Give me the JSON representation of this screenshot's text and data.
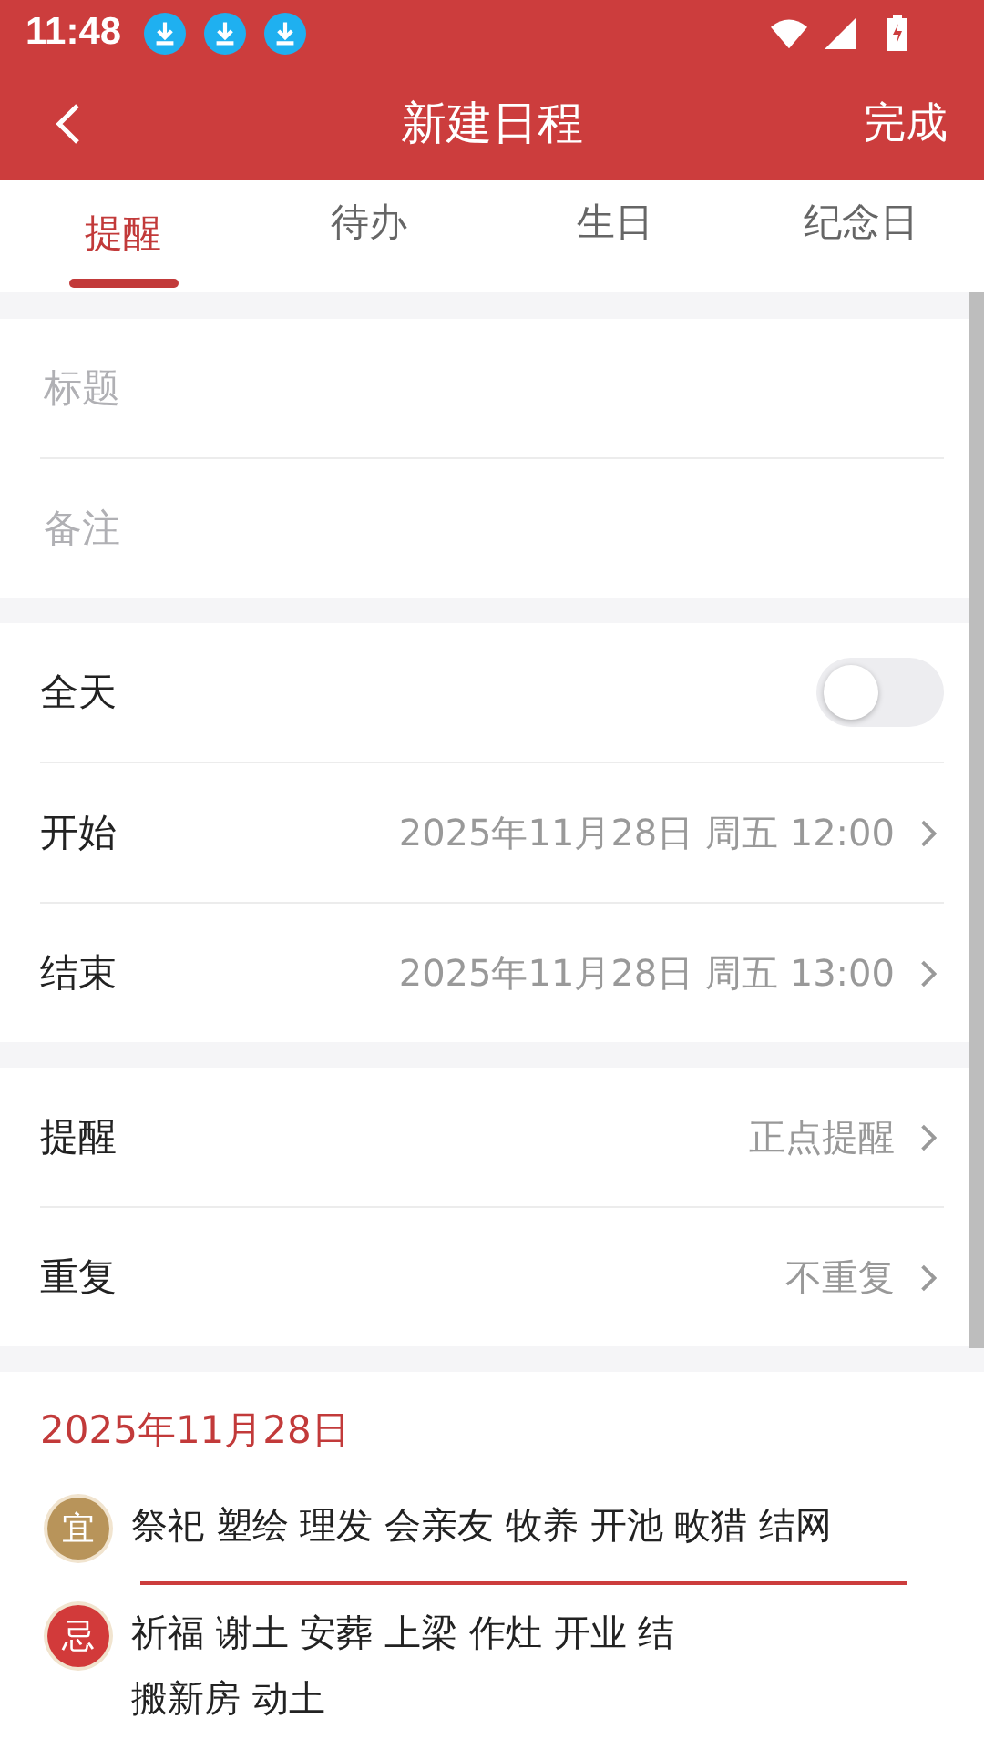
{
  "status_bar": {
    "time": "11:48",
    "notifications": [
      {
        "kind": "download"
      },
      {
        "kind": "download"
      },
      {
        "kind": "download"
      }
    ]
  },
  "header": {
    "title": "新建日程",
    "action": "完成"
  },
  "tabs": [
    {
      "label": "提醒",
      "selected": true
    },
    {
      "label": "待办",
      "selected": false
    },
    {
      "label": "生日",
      "selected": false
    },
    {
      "label": "纪念日",
      "selected": false
    }
  ],
  "inputs": [
    {
      "placeholder": "标题"
    },
    {
      "placeholder": "备注"
    }
  ],
  "time_section": {
    "all_day": {
      "label": "全天",
      "on": false
    },
    "rows": [
      {
        "label": "开始",
        "value": "2025年11月28日 周五 12:00"
      },
      {
        "label": "结束",
        "value": "2025年11月28日 周五 13:00"
      }
    ]
  },
  "reminder_section": [
    {
      "label": "提醒",
      "value": "正点提醒"
    },
    {
      "label": "重复",
      "value": "不重复"
    }
  ],
  "almanac": {
    "date": "2025年11月28日",
    "entries": [
      {
        "badge": "宜",
        "kind": "good",
        "lines": [
          "祭祀 塑绘 理发 会亲友 牧养 开池 畋猎 结网"
        ]
      },
      {
        "badge": "忌",
        "kind": "bad",
        "lines": [
          "祈福 谢土 安葬 上梁 作灶 开业 结",
          "搬新房 动土"
        ]
      }
    ]
  }
}
